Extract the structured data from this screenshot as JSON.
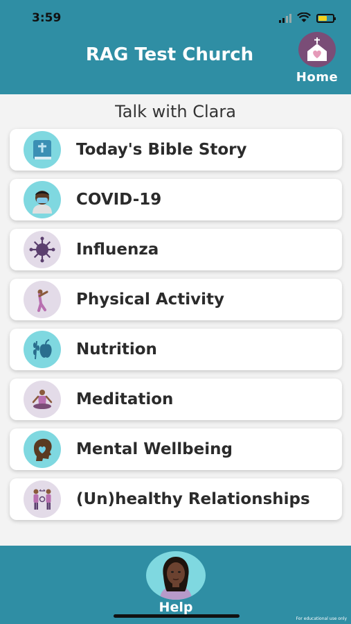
{
  "status_bar": {
    "time": "3:59",
    "icons": [
      "signal-icon",
      "wifi-icon",
      "battery-charging-icon"
    ]
  },
  "header": {
    "title": "RAG Test Church",
    "home_label": "Home",
    "home_icon": "church-heart-icon",
    "background_color": "#2f8ea4"
  },
  "subtitle": "Talk with Clara",
  "menu": {
    "items": [
      {
        "label": "Today's Bible Story",
        "icon": "bible-icon",
        "icon_bg": "#7fd8e0"
      },
      {
        "label": "COVID-19",
        "icon": "masked-person-icon",
        "icon_bg": "#7fd8e0"
      },
      {
        "label": "Influenza",
        "icon": "virus-icon",
        "icon_bg": "#e3dbe8"
      },
      {
        "label": "Physical Activity",
        "icon": "stretching-person-icon",
        "icon_bg": "#e3dbe8"
      },
      {
        "label": "Nutrition",
        "icon": "apple-wheat-icon",
        "icon_bg": "#7fd8e0"
      },
      {
        "label": "Meditation",
        "icon": "meditation-icon",
        "icon_bg": "#e3dbe8"
      },
      {
        "label": "Mental Wellbeing",
        "icon": "head-heart-icon",
        "icon_bg": "#7fd8e0"
      },
      {
        "label": "(Un)healthy Relationships",
        "icon": "relationship-icon",
        "icon_bg": "#e3dbe8"
      }
    ]
  },
  "footer": {
    "help_label": "Help",
    "avatar": "clara-avatar",
    "footnote": "For educational use only"
  }
}
